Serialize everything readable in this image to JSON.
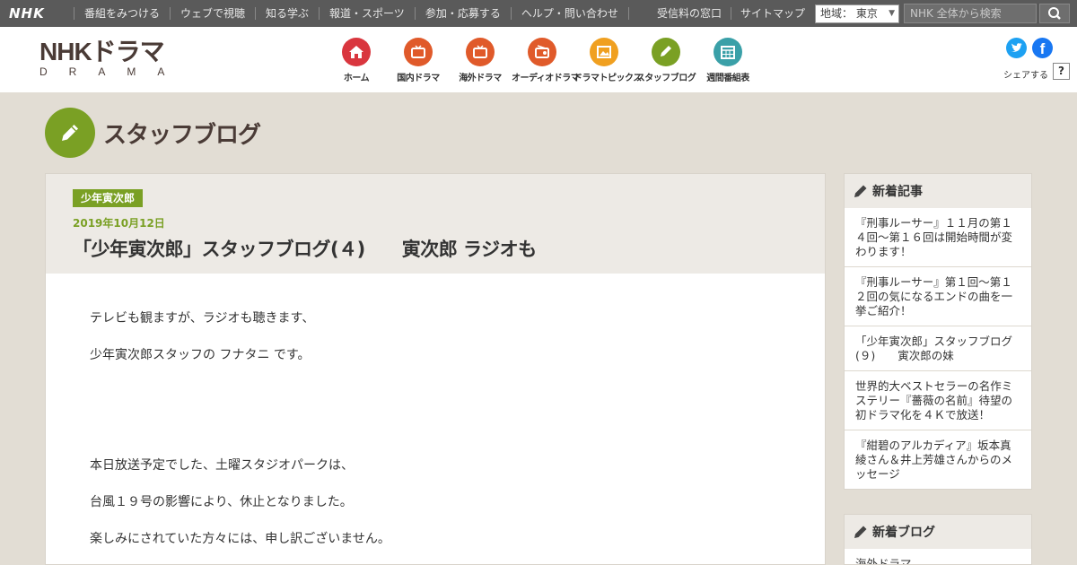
{
  "topbar": {
    "logo": "NHK",
    "nav": [
      "番組をみつける",
      "ウェブで視聴",
      "知る学ぶ",
      "報道・スポーツ",
      "参加・応募する",
      "ヘルプ・問い合わせ"
    ],
    "links": [
      "受信料の窓口",
      "サイトマップ"
    ],
    "region_value": "地域： 東京",
    "search_placeholder": "NHK 全体から検索"
  },
  "header": {
    "brand_main": "NHKドラマ",
    "brand_sub": "DRAMA",
    "nav": [
      {
        "label": "ホーム",
        "icon": "home-icon",
        "color": "#d9363e"
      },
      {
        "label": "国内ドラマ",
        "icon": "tv-icon",
        "color": "#e05a2a"
      },
      {
        "label": "海外ドラマ",
        "icon": "tv-icon",
        "color": "#e05a2a"
      },
      {
        "label": "オーディオドラマ",
        "icon": "radio-icon",
        "color": "#e05a2a"
      },
      {
        "label": "ドラマトピックス",
        "icon": "picture-icon",
        "color": "#f0a020"
      },
      {
        "label": "スタッフブログ",
        "icon": "pencil-icon",
        "color": "#7aa024"
      },
      {
        "label": "週間番組表",
        "icon": "calendar-icon",
        "color": "#3aa0a8"
      }
    ],
    "share_label": "シェアする",
    "help_label": "?"
  },
  "page": {
    "title": "スタッフブログ"
  },
  "article": {
    "tag": "少年寅次郎",
    "date": "2019年10月12日",
    "title": "「少年寅次郎」スタッフブログ(４)　　寅次郎 ラジオも",
    "paragraphs": [
      "テレビも観ますが、ラジオも聴きます、",
      "少年寅次郎スタッフの フナタニ です。",
      "本日放送予定でした、土曜スタジオパークは、",
      "台風１９号の影響により、休止となりました。",
      "楽しみにされていた方々には、申し訳ございません。"
    ]
  },
  "sidebar": {
    "new_articles_title": "新着記事",
    "new_articles": [
      "『刑事ルーサー』１１月の第１４回～第１６回は開始時間が変わります！",
      "『刑事ルーサー』第１回～第１２回の気になるエンドの曲を一挙ご紹介！",
      "「少年寅次郎」スタッフブログ(９)　　寅次郎の妹",
      "世界的大ベストセラーの名作ミステリー『薔薇の名前』待望の初ドラマ化を４Ｋで放送！",
      "『紺碧のアルカディア』坂本真綾さん＆井上芳雄さんからのメッセージ"
    ],
    "new_blogs_title": "新着ブログ",
    "new_blogs": [
      "海外ドラマ"
    ]
  }
}
